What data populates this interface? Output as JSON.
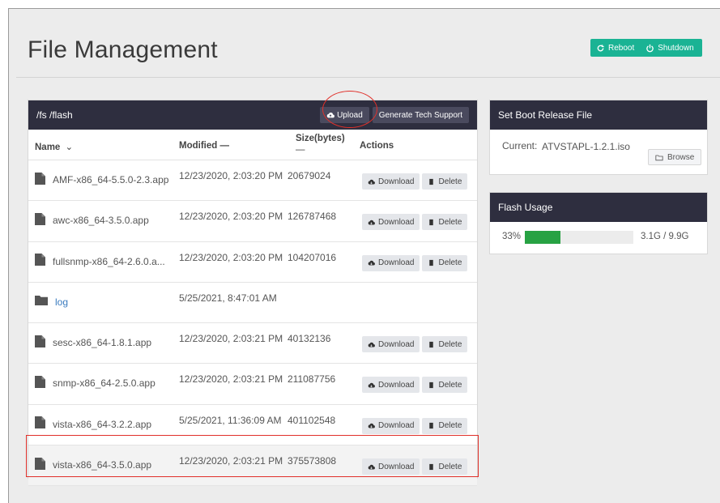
{
  "page": {
    "title": "File Management"
  },
  "header_actions": {
    "reboot": "Reboot",
    "shutdown": "Shutdown",
    "color": "#1ab394"
  },
  "files": {
    "path": "/fs /flash",
    "upload": "Upload",
    "tech_support": "Generate Tech Support",
    "columns": {
      "name": "Name",
      "modified": "Modified —",
      "size": "Size(bytes)",
      "size_sub": "—",
      "actions": "Actions"
    },
    "download_label": "Download",
    "delete_label": "Delete",
    "rows": [
      {
        "name": "AMF-x86_64-5.5.0-2.3.app",
        "modified": "12/23/2020, 2:03:20 PM",
        "size": "20679024",
        "type": "file"
      },
      {
        "name": "awc-x86_64-3.5.0.app",
        "modified": "12/23/2020, 2:03:20 PM",
        "size": "126787468",
        "type": "file"
      },
      {
        "name": "fullsnmp-x86_64-2.6.0.a...",
        "modified": "12/23/2020, 2:03:20 PM",
        "size": "104207016",
        "type": "file"
      },
      {
        "name": "log",
        "modified": "5/25/2021, 8:47:01 AM",
        "size": "",
        "type": "folder"
      },
      {
        "name": "sesc-x86_64-1.8.1.app",
        "modified": "12/23/2020, 2:03:21 PM",
        "size": "40132136",
        "type": "file"
      },
      {
        "name": "snmp-x86_64-2.5.0.app",
        "modified": "12/23/2020, 2:03:21 PM",
        "size": "211087756",
        "type": "file"
      },
      {
        "name": "vista-x86_64-3.2.2.app",
        "modified": "5/25/2021, 11:36:09 AM",
        "size": "401102548",
        "type": "file"
      },
      {
        "name": "vista-x86_64-3.5.0.app",
        "modified": "12/23/2020, 2:03:21 PM",
        "size": "375573808",
        "type": "file"
      }
    ]
  },
  "boot": {
    "title": "Set Boot Release File",
    "current_label": "Current:",
    "current_value": "ATVSTAPL-1.2.1.iso",
    "browse": "Browse"
  },
  "flash": {
    "title": "Flash Usage",
    "percent_text": "33%",
    "percent": 0.33,
    "usage_text": "3.1G / 9.9G",
    "bar_color": "#27a243"
  }
}
